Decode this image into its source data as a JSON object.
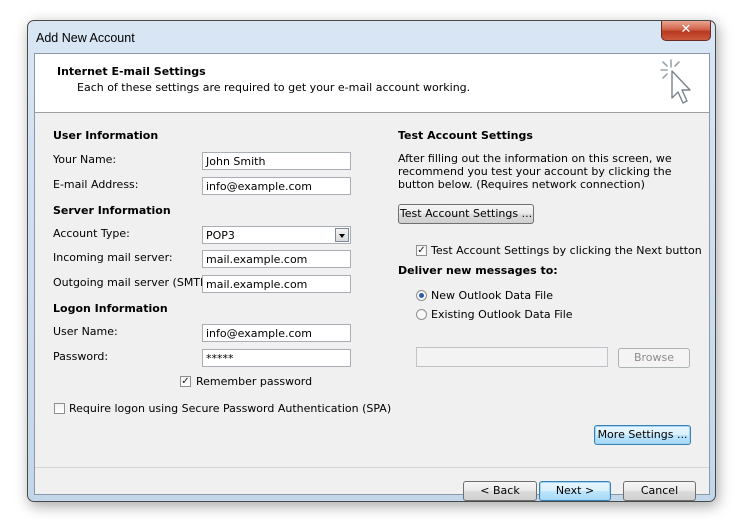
{
  "window": {
    "title": "Add New Account",
    "close_label": "✕"
  },
  "banner": {
    "title": "Internet E-mail Settings",
    "subtitle": "Each of these settings are required to get your e-mail account working."
  },
  "user_info": {
    "heading": "User Information",
    "name_label": "Your Name:",
    "name_value": "John Smith",
    "email_label": "E-mail Address:",
    "email_value": "info@example.com"
  },
  "server_info": {
    "heading": "Server Information",
    "account_type_label": "Account Type:",
    "account_type_value": "POP3",
    "incoming_label": "Incoming mail server:",
    "incoming_value": "mail.example.com",
    "outgoing_label": "Outgoing mail server (SMTP):",
    "outgoing_value": "mail.example.com"
  },
  "logon_info": {
    "heading": "Logon Information",
    "username_label": "User Name:",
    "username_value": "info@example.com",
    "password_label": "Password:",
    "password_value": "*****",
    "remember_label": "Remember password",
    "remember_checked": true,
    "spa_label": "Require logon using Secure Password Authentication (SPA)",
    "spa_checked": false
  },
  "test_settings": {
    "heading": "Test Account Settings",
    "description": "After filling out the information on this screen, we recommend you test your account by clicking the button below. (Requires network connection)",
    "test_button": "Test Account Settings ...",
    "next_checkbox_label": "Test Account Settings by clicking the Next button",
    "next_checkbox_checked": true
  },
  "deliver": {
    "heading": "Deliver new messages to:",
    "option_new": "New Outlook Data File",
    "option_existing": "Existing Outlook Data File",
    "selected": "new",
    "existing_path": "",
    "browse_button": "Browse"
  },
  "more_settings_button": "More Settings ...",
  "footer": {
    "back_button": "< Back",
    "next_button": "Next >",
    "cancel_button": "Cancel"
  },
  "colors": {
    "window_frame": "#c4d6ea",
    "close_button": "#c8482e",
    "dialog_bg": "#f0f0f0",
    "radio_selected": "#2b5da8"
  }
}
